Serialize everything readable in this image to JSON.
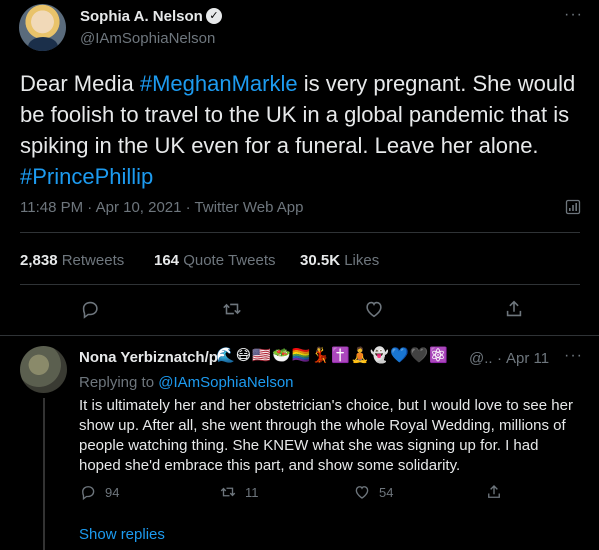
{
  "tweet": {
    "author_name": "Sophia A. Nelson",
    "author_handle": "@IAmSophiaNelson",
    "verified_icon": "verified-badge-icon",
    "text_parts": {
      "p1": "Dear Media ",
      "tag1": "#MeghanMarkle",
      "p2": " is very pregnant. She would be foolish to travel to the UK in a global pandemic that is spiking in the UK even for a funeral. Leave her alone.",
      "tag2": "#PrincePhillip"
    },
    "meta": "11:48 PM · Apr 10, 2021 · Twitter Web App",
    "stats": {
      "retweets_count": "2,838",
      "retweets_label": "Retweets",
      "quotes_count": "164",
      "quotes_label": "Quote Tweets",
      "likes_count": "30.5K",
      "likes_label": "Likes"
    }
  },
  "reply": {
    "author_name": "Nona Yerbiznatch/p",
    "author_emoji": "🌊😷🇺🇸🥗🏳️‍🌈💃✝️🧘👻💙🖤⚛️",
    "author_handle": "@..",
    "separator": "·",
    "time": "Apr 11",
    "replying_label": "Replying to",
    "replying_to": "@IAmSophiaNelson",
    "text": "It is ultimately her and her obstetrician's choice, but I would love to see her show up.  After all, she went through the whole Royal Wedding, millions of people watching thing.  She KNEW what she was signing up for.  I had hoped she'd embrace this part, and show some solidarity.",
    "reply_count": "94",
    "retweet_count": "11",
    "like_count": "54",
    "show_replies": "Show replies"
  },
  "colors": {
    "background": "#000000",
    "text": "#e7e9ea",
    "muted": "#6e767d",
    "link": "#1d9bf0",
    "border": "#2f3336"
  }
}
